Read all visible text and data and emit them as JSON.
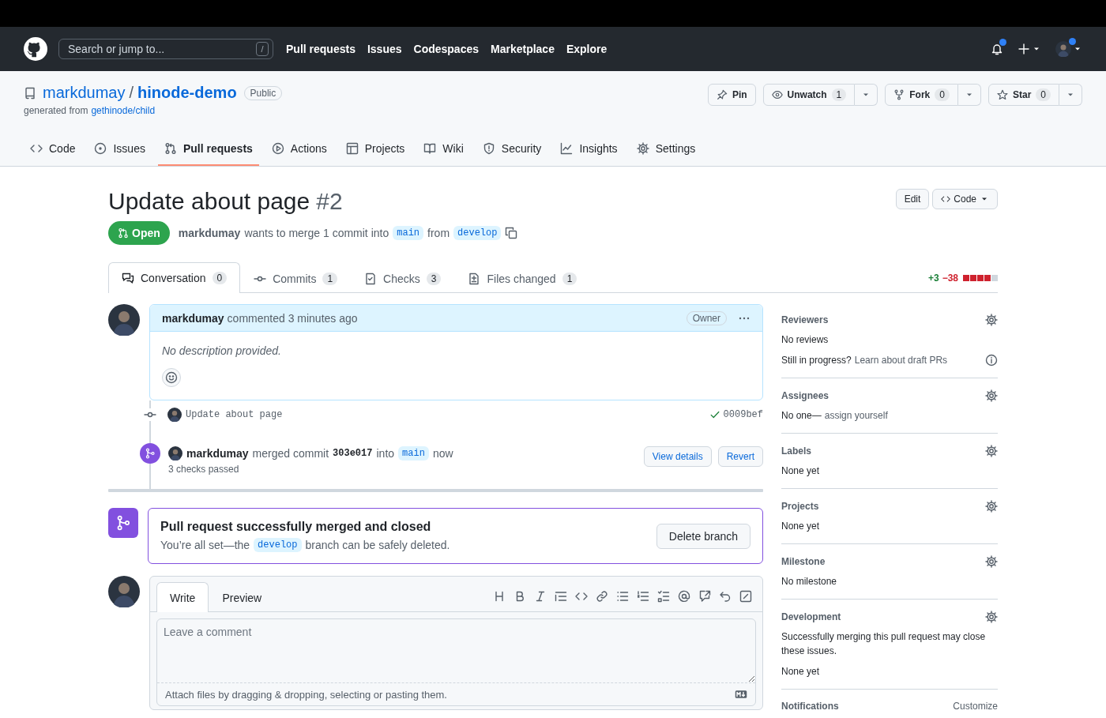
{
  "global_nav": {
    "search": {
      "placeholder": "Search or jump to...",
      "shortcut": "/"
    },
    "links": [
      "Pull requests",
      "Issues",
      "Codespaces",
      "Marketplace",
      "Explore"
    ],
    "notifications_unread": true,
    "avatar_status": true
  },
  "repo": {
    "owner": "markdumay",
    "separator": "/",
    "name": "hinode-demo",
    "visibility": "Public",
    "generated_from": "generated from",
    "template": "gethinode/child",
    "actions": [
      {
        "label": "Pin"
      },
      {
        "label": "Unwatch",
        "count": "1",
        "menu": true
      },
      {
        "label": "Fork",
        "count": "0",
        "menu": true
      },
      {
        "label": "Star",
        "count": "0",
        "menu": true
      }
    ]
  },
  "repo_tabs": [
    {
      "label": "Code",
      "selected": false
    },
    {
      "label": "Issues",
      "selected": false
    },
    {
      "label": "Pull requests",
      "selected": true
    },
    {
      "label": "Actions",
      "selected": false
    },
    {
      "label": "Projects",
      "selected": false
    },
    {
      "label": "Wiki",
      "selected": false
    },
    {
      "label": "Security",
      "selected": false
    },
    {
      "label": "Insights",
      "selected": false
    },
    {
      "label": "Settings",
      "selected": false
    }
  ],
  "pull_request": {
    "title": "Update about page",
    "number": "#2",
    "state": "Open",
    "author": "markdumay",
    "summary": "wants to merge 1 commit into",
    "base": "main",
    "from": "from",
    "head": "develop",
    "buttons": [
      "Edit",
      "Code"
    ]
  },
  "pr_tabs": [
    {
      "label": "Conversation",
      "count": "0",
      "selected": true
    },
    {
      "label": "Commits",
      "count": "1",
      "selected": false
    },
    {
      "label": "Checks",
      "count": "3",
      "selected": false
    },
    {
      "label": "Files changed",
      "count": "1",
      "selected": false
    }
  ],
  "diffstat": {
    "additions": "+3",
    "deletions": "−38",
    "blocks": [
      {
        "color": "#cf222e"
      },
      {
        "color": "#cf222e"
      },
      {
        "color": "#cf222e"
      },
      {
        "color": "#cf222e"
      },
      {
        "color": "#d0d7de"
      }
    ]
  },
  "timeline": [
    {
      "kind": "comment",
      "author": "markdumay",
      "action": "commented 3 minutes ago",
      "role": "Owner",
      "body": "No description provided."
    },
    {
      "kind": "commit",
      "message": "Update about page",
      "sha": "0009bef",
      "check_passed": true
    },
    {
      "kind": "merge",
      "author": "markdumay",
      "action": "merged commit",
      "sha": "303e017",
      "into": "into",
      "base": "main",
      "time": "now",
      "checks": "3 checks passed",
      "buttons": [
        "View details",
        "Revert"
      ]
    }
  ],
  "merge_status": {
    "title": "Pull request successfully merged and closed",
    "message_before": "You’re all set—the",
    "branch": "develop",
    "message_after": "branch can be safely deleted.",
    "button": "Delete branch"
  },
  "comment_form": {
    "tabs": [
      {
        "label": "Write",
        "selected": true
      },
      {
        "label": "Preview",
        "selected": false
      }
    ],
    "placeholder": "Leave a comment",
    "hint": "Attach files by dragging & dropping, selecting or pasting them."
  },
  "sidebar": [
    {
      "title": "Reviewers",
      "lines": [
        {
          "text": "No reviews"
        },
        {
          "text": "Still in progress?",
          "link": "Learn about draft PRs",
          "info": true
        }
      ]
    },
    {
      "title": "Assignees",
      "lines": [
        {
          "text": "No one—",
          "link": "assign yourself"
        }
      ]
    },
    {
      "title": "Labels",
      "lines": [
        {
          "text": "None yet"
        }
      ]
    },
    {
      "title": "Projects",
      "lines": [
        {
          "text": "None yet"
        }
      ]
    },
    {
      "title": "Milestone",
      "lines": [
        {
          "text": "No milestone"
        }
      ]
    },
    {
      "title": "Development",
      "lines": [
        {
          "text": "Successfully merging this pull request may close these issues."
        },
        {
          "text": "None yet"
        }
      ]
    },
    {
      "title": "Notifications",
      "action": "Customize"
    }
  ]
}
